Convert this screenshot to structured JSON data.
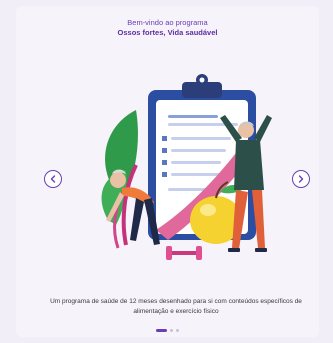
{
  "header": {
    "welcome": "Bem-vindo ao programa",
    "program_name": "Ossos fortes, Vida saudável"
  },
  "carousel": {
    "prev_icon": "chevron-left-icon",
    "next_icon": "chevron-right-icon",
    "description": "Um programa de saúde de 12 meses desenhado para si com conteúdos específicos de alimentação e exercício físico",
    "slide_count": 3,
    "active_slide": 1
  },
  "colors": {
    "accent": "#6a3fb3",
    "background": "#f6f3fb",
    "text": "#3a3a3a",
    "dot_inactive": "#cbbfe0"
  },
  "illustration": {
    "subject": "seniors-exercising-clipboard-measuring-tape-apple-dumbbell"
  }
}
